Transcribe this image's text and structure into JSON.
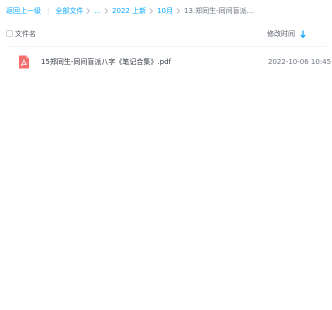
{
  "breadcrumb": {
    "back_label": "返回上一级",
    "items": [
      {
        "label": "全部文件"
      },
      {
        "label": "..."
      },
      {
        "label": "2022 上新"
      },
      {
        "label": "10月"
      }
    ],
    "current": "13.郑同生-同间盲派..."
  },
  "columns": {
    "name_label": "文件名",
    "time_label": "修改时间",
    "sort_icon": "sort-descending-arrow"
  },
  "files": [
    {
      "icon": "pdf-file-icon",
      "name": "15郑同生-同间盲派八字《笔记合集》.pdf",
      "modified": "2022-10-06 10:45"
    }
  ],
  "colors": {
    "accent": "#06a7ff",
    "pdf_icon": "#f56c6c",
    "text_primary": "#303640",
    "text_secondary": "#6b7280"
  }
}
